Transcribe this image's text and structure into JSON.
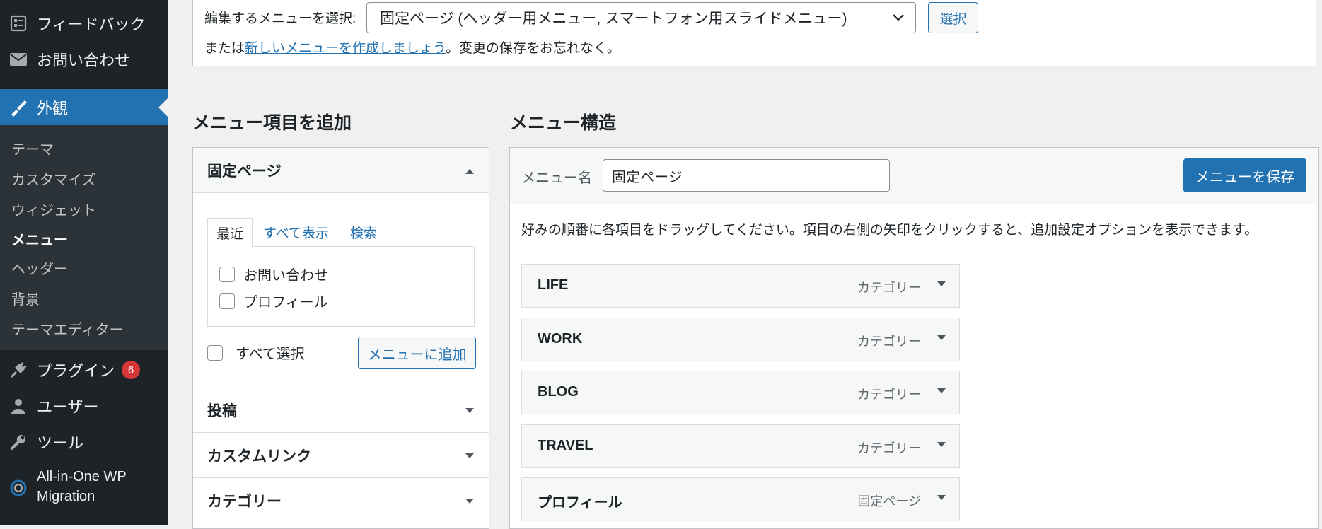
{
  "sidebar": {
    "top_items": [
      {
        "label": "フィードバック",
        "icon": "feedback-icon"
      },
      {
        "label": "お問い合わせ",
        "icon": "mail-icon"
      }
    ],
    "appearance": {
      "label": "外観",
      "icon": "paintbrush-icon"
    },
    "submenu": [
      "テーマ",
      "カスタマイズ",
      "ウィジェット",
      "メニュー",
      "ヘッダー",
      "背景",
      "テーマエディター"
    ],
    "bottom_items": [
      {
        "label": "プラグイン",
        "icon": "plugin-icon",
        "badge": "6"
      },
      {
        "label": "ユーザー",
        "icon": "user-icon"
      },
      {
        "label": "ツール",
        "icon": "wrench-icon"
      },
      {
        "label_line1": "All-in-One WP",
        "label_line2": "Migration",
        "icon": "migration-icon"
      }
    ],
    "colors": {
      "background": "#1d2327",
      "active": "#2271b1",
      "badge": "#d63638"
    }
  },
  "select_menu": {
    "label": "編集するメニューを選択:",
    "selected": "固定ページ (ヘッダー用メニュー, スマートフォン用スライドメニュー)",
    "button": "選択",
    "note_prefix": "または",
    "note_link": "新しいメニューを作成しましょう",
    "note_suffix": "。変更の保存をお忘れなく。"
  },
  "add_items": {
    "heading": "メニュー項目を追加",
    "pages_section": "固定ページ",
    "tabs": [
      "最近",
      "すべて表示",
      "検索"
    ],
    "checkboxes": [
      "お問い合わせ",
      "プロフィール"
    ],
    "select_all": "すべて選択",
    "add_button": "メニューに追加",
    "sections": [
      "投稿",
      "カスタムリンク",
      "カテゴリー"
    ]
  },
  "structure": {
    "heading": "メニュー構造",
    "name_label": "メニュー名",
    "name_value": "固定ページ",
    "save_button": "メニューを保存",
    "instructions": "好みの順番に各項目をドラッグしてください。項目の右側の矢印をクリックすると、追加設定オプションを表示できます。",
    "items": [
      {
        "title": "LIFE",
        "type": "カテゴリー"
      },
      {
        "title": "WORK",
        "type": "カテゴリー"
      },
      {
        "title": "BLOG",
        "type": "カテゴリー"
      },
      {
        "title": "TRAVEL",
        "type": "カテゴリー"
      },
      {
        "title": "プロフィール",
        "type": "固定ページ"
      }
    ]
  }
}
